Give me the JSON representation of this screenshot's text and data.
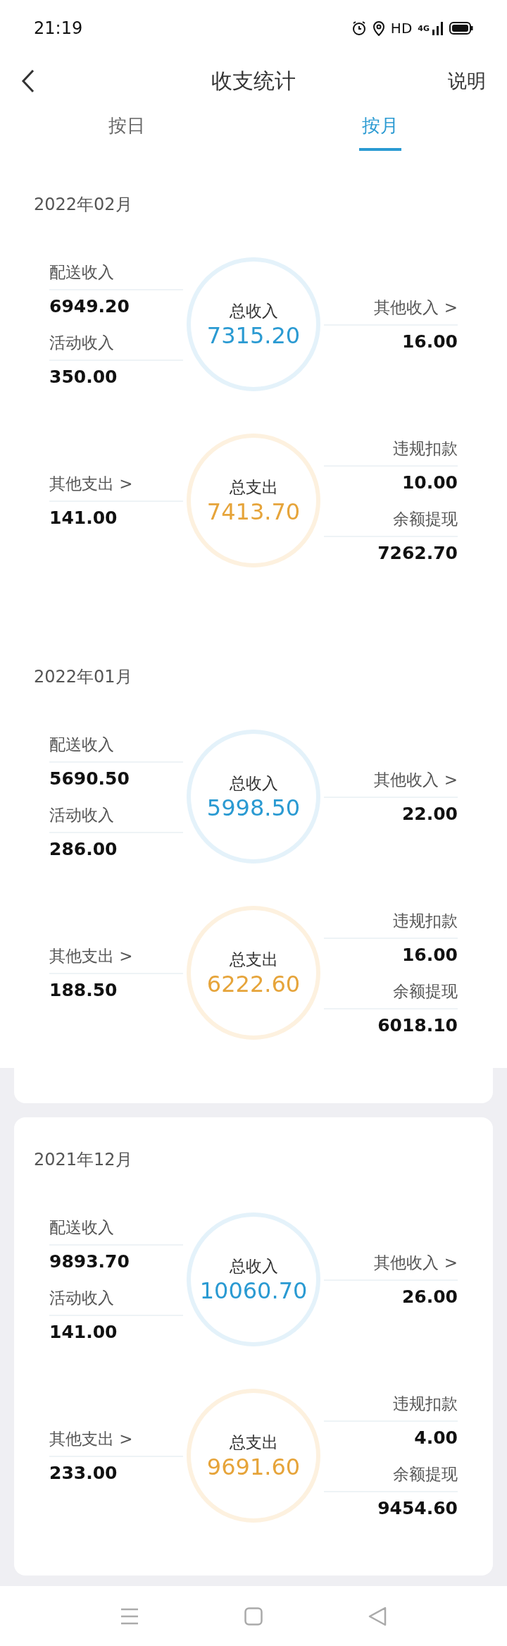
{
  "status_bar": {
    "time": "21:19",
    "hd": "HD",
    "network": "4G"
  },
  "header": {
    "title": "收支统计",
    "action": "说明"
  },
  "tabs": [
    {
      "label": "按日",
      "selected": false
    },
    {
      "label": "按月",
      "selected": true
    }
  ],
  "months": [
    {
      "month": "2022年02月",
      "carded": false,
      "groups": [
        {
          "kind": "income",
          "title": "总收入",
          "total": "7315.20",
          "left": [
            {
              "label": "配送收入",
              "value": "6949.20"
            },
            {
              "label": "活动收入",
              "value": "350.00"
            }
          ],
          "right": [
            {
              "label": "其他收入 >",
              "value": "16.00"
            }
          ]
        },
        {
          "kind": "expense",
          "title": "总支出",
          "total": "7413.70",
          "left": [
            {
              "label": "其他支出 >",
              "value": "141.00"
            }
          ],
          "right": [
            {
              "label": "违规扣款",
              "value": "10.00"
            },
            {
              "label": "余额提现",
              "value": "7262.70"
            }
          ]
        }
      ]
    },
    {
      "month": "2022年01月",
      "carded": false,
      "groups": [
        {
          "kind": "income",
          "title": "总收入",
          "total": "5998.50",
          "left": [
            {
              "label": "配送收入",
              "value": "5690.50"
            },
            {
              "label": "活动收入",
              "value": "286.00"
            }
          ],
          "right": [
            {
              "label": "其他收入 >",
              "value": "22.00"
            }
          ]
        },
        {
          "kind": "expense",
          "title": "总支出",
          "total": "6222.60",
          "left": [
            {
              "label": "其他支出 >",
              "value": "188.50"
            }
          ],
          "right": [
            {
              "label": "违规扣款",
              "value": "16.00"
            },
            {
              "label": "余额提现",
              "value": "6018.10"
            }
          ]
        }
      ]
    },
    {
      "month": "2021年12月",
      "carded": true,
      "groups": [
        {
          "kind": "income",
          "title": "总收入",
          "total": "10060.70",
          "left": [
            {
              "label": "配送收入",
              "value": "9893.70"
            },
            {
              "label": "活动收入",
              "value": "141.00"
            }
          ],
          "right": [
            {
              "label": "其他收入 >",
              "value": "26.00"
            }
          ]
        },
        {
          "kind": "expense",
          "title": "总支出",
          "total": "9691.60",
          "left": [
            {
              "label": "其他支出 >",
              "value": "233.00"
            }
          ],
          "right": [
            {
              "label": "违规扣款",
              "value": "4.00"
            },
            {
              "label": "余额提现",
              "value": "9454.60"
            }
          ]
        }
      ]
    }
  ]
}
